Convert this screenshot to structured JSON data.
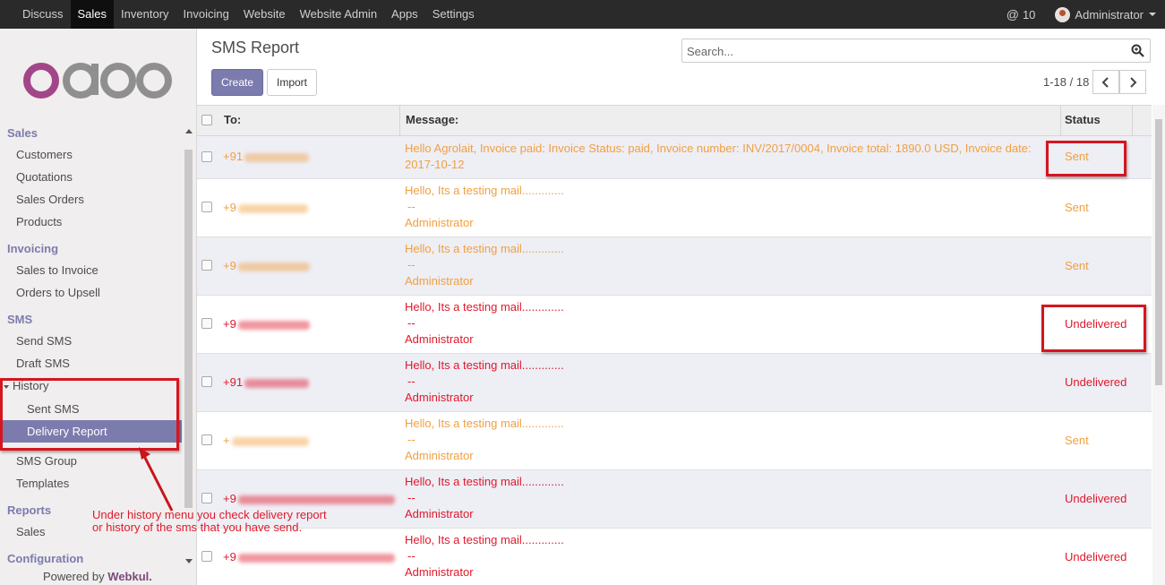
{
  "topbar": {
    "menu": [
      "Discuss",
      "Sales",
      "Inventory",
      "Invoicing",
      "Website",
      "Website Admin",
      "Apps",
      "Settings"
    ],
    "active": "Sales",
    "messages_count": "10",
    "user": "Administrator"
  },
  "sidebar": {
    "sections": {
      "sales": "Sales",
      "invoicing": "Invoicing",
      "sms": "SMS",
      "reports": "Reports",
      "configuration": "Configuration"
    },
    "items": {
      "customers": "Customers",
      "quotations": "Quotations",
      "sales_orders": "Sales Orders",
      "products": "Products",
      "sales_to_invoice": "Sales to Invoice",
      "orders_to_upsell": "Orders to Upsell",
      "send_sms": "Send SMS",
      "draft_sms": "Draft SMS",
      "history": "History",
      "sent_sms": "Sent SMS",
      "delivery_report": "Delivery Report",
      "sms_group": "SMS Group",
      "templates": "Templates",
      "reports_sales": "Sales"
    },
    "powered_prefix": "Powered by",
    "powered_brand": "Webkul."
  },
  "control": {
    "title": "SMS Report",
    "create_label": "Create",
    "import_label": "Import",
    "search_placeholder": "Search...",
    "pager": "1-18 / 18"
  },
  "table": {
    "headers": {
      "to": "To:",
      "message": "Message:",
      "status": "Status"
    },
    "rows": [
      {
        "to": "+91",
        "message_line1": "Hello Agrolait, Invoice paid: Invoice Status: paid, Invoice number: INV/2017/0004, Invoice total: 1890.0 USD, Invoice date:",
        "message_line2": "2017-10-12",
        "message_line3": "",
        "status": "Sent",
        "color": "#f0a040"
      },
      {
        "to": "+9",
        "message_line1": "Hello, Its a testing mail.............",
        "message_line2": "--",
        "message_line3": "Administrator",
        "status": "Sent",
        "color": "#f0a040"
      },
      {
        "to": "+9",
        "message_line1": "Hello, Its a testing mail.............",
        "message_line2": "--",
        "message_line3": "Administrator",
        "status": "Sent",
        "color": "#f0a040"
      },
      {
        "to": "+9",
        "message_line1": "Hello, Its a testing mail.............",
        "message_line2": "--",
        "message_line3": "Administrator",
        "status": "Undelivered",
        "color": "#e0192b"
      },
      {
        "to": "+91",
        "message_line1": "Hello, Its a testing mail.............",
        "message_line2": "--",
        "message_line3": "Administrator",
        "status": "Undelivered",
        "color": "#e0192b"
      },
      {
        "to": "+",
        "message_line1": "Hello, Its a testing mail.............",
        "message_line2": "--",
        "message_line3": "Administrator",
        "status": "Sent",
        "color": "#f0a040"
      },
      {
        "to": "+9",
        "message_line1": "Hello, Its a testing mail.............",
        "message_line2": "--",
        "message_line3": "Administrator",
        "status": "Undelivered",
        "color": "#e0192b"
      },
      {
        "to": "+9",
        "message_line1": "Hello, Its a testing mail.............",
        "message_line2": "--",
        "message_line3": "Administrator",
        "status": "Undelivered",
        "color": "#e0192b"
      }
    ]
  },
  "annotation": {
    "line1": "Under history menu you check delivery report",
    "line2": "or history of the sms that you have send."
  },
  "colors": {
    "brand": "#7c7bad",
    "sent": "#f0a040",
    "undelivered": "#e0192b",
    "annotation": "#d6151f"
  }
}
